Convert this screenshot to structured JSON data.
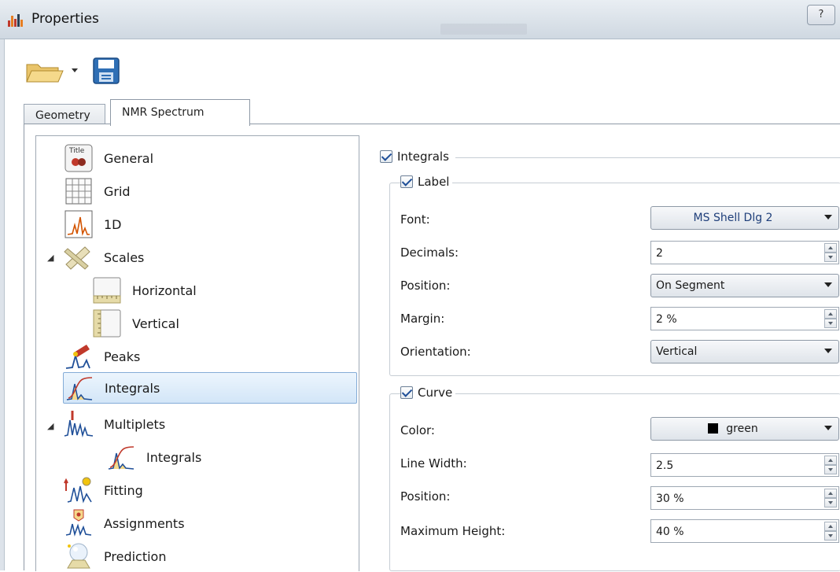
{
  "window": {
    "title": "Properties",
    "help_glyph": "?"
  },
  "toolbar": {
    "open_icon": "folder-open-icon",
    "open_dropdown_icon": "chevron-down-icon",
    "save_icon": "save-disk-icon"
  },
  "tabs": [
    {
      "label": "Geometry",
      "active": false
    },
    {
      "label": "NMR Spectrum",
      "active": true
    }
  ],
  "tree": {
    "items": [
      {
        "label": "General",
        "icon": "title-icon",
        "level": 0
      },
      {
        "label": "Grid",
        "icon": "grid-icon",
        "level": 0
      },
      {
        "label": "1D",
        "icon": "spectrum-1d-icon",
        "level": 0
      },
      {
        "label": "Scales",
        "icon": "scales-icon",
        "level": 0,
        "expanded": true
      },
      {
        "label": "Horizontal",
        "icon": "horizontal-scale-icon",
        "level": 1
      },
      {
        "label": "Vertical",
        "icon": "vertical-scale-icon",
        "level": 1
      },
      {
        "label": "Peaks",
        "icon": "peaks-icon",
        "level": 0
      },
      {
        "label": "Integrals",
        "icon": "integrals-icon",
        "level": 0,
        "selected": true
      },
      {
        "label": "Multiplets",
        "icon": "multiplets-icon",
        "level": 0,
        "expanded": true
      },
      {
        "label": "Integrals",
        "icon": "integrals-icon",
        "level": 1
      },
      {
        "label": "Fitting",
        "icon": "fitting-icon",
        "level": 0
      },
      {
        "label": "Assignments",
        "icon": "assignments-icon",
        "level": 0
      },
      {
        "label": "Prediction",
        "icon": "prediction-icon",
        "level": 0
      }
    ]
  },
  "integrals": {
    "checked": true,
    "label": "Integrals",
    "label_group": {
      "checked": true,
      "title": "Label",
      "font_label": "Font:",
      "font_value": "MS Shell Dlg 2",
      "decimals_label": "Decimals:",
      "decimals_value": "2",
      "position_label": "Position:",
      "position_value": "On Segment",
      "margin_label": "Margin:",
      "margin_value": "2 %",
      "orientation_label": "Orientation:",
      "orientation_value": "Vertical"
    },
    "curve_group": {
      "checked": true,
      "title": "Curve",
      "color_label": "Color:",
      "color_value": "green",
      "color_swatch": "#000000",
      "line_width_label": "Line Width:",
      "line_width_value": "2.5",
      "position_label": "Position:",
      "position_value": "30 %",
      "max_height_label": "Maximum Height:",
      "max_height_value": "40 %"
    }
  }
}
